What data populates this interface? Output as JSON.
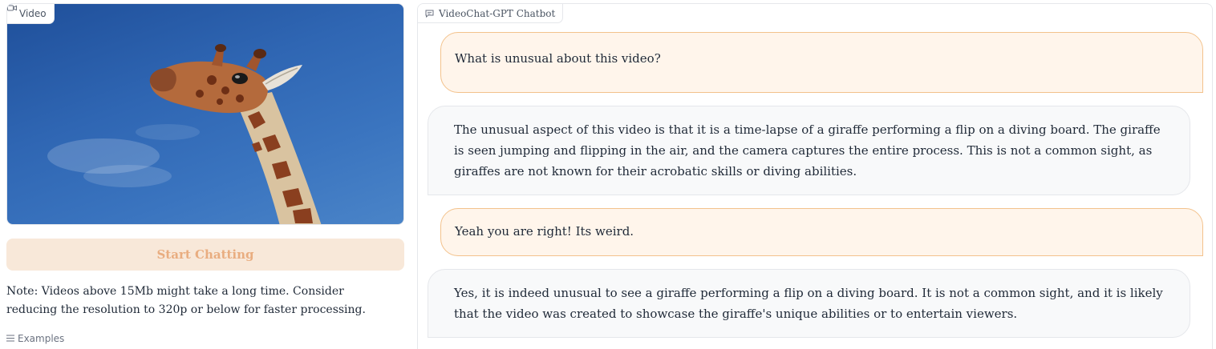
{
  "video": {
    "tab_label": "Video"
  },
  "controls": {
    "start_label": "Start Chatting",
    "note": "Note: Videos above 15Mb might take a long time. Consider reducing the resolution to 320p or below for faster processing.",
    "examples_label": "Examples"
  },
  "chatbot": {
    "tab_label": "VideoChat-GPT Chatbot",
    "messages": [
      {
        "role": "user",
        "text": "What is unusual about this video?"
      },
      {
        "role": "bot",
        "text": "The unusual aspect of this video is that it is a time-lapse of a giraffe performing a flip on a diving board. The giraffe is seen jumping and flipping in the air, and the camera captures the entire process. This is not a common sight, as giraffes are not known for their acrobatic skills or diving abilities."
      },
      {
        "role": "user",
        "text": "Yeah you are right! Its weird."
      },
      {
        "role": "bot",
        "text": "Yes, it is indeed unusual to see a giraffe performing a flip on a diving board. It is not a common sight, and it is likely that the video was created to showcase the giraffe's unique abilities or to entertain viewers."
      }
    ]
  },
  "colors": {
    "accent": "#f3c28c",
    "user_bubble": "#fff5eb",
    "bot_bubble": "#f8f9fa",
    "button_bg": "#f8e8d9",
    "button_text": "#e9ad80",
    "sky": "#2f66b3"
  },
  "icons": [
    "video-icon",
    "chat-icon",
    "list-icon"
  ]
}
